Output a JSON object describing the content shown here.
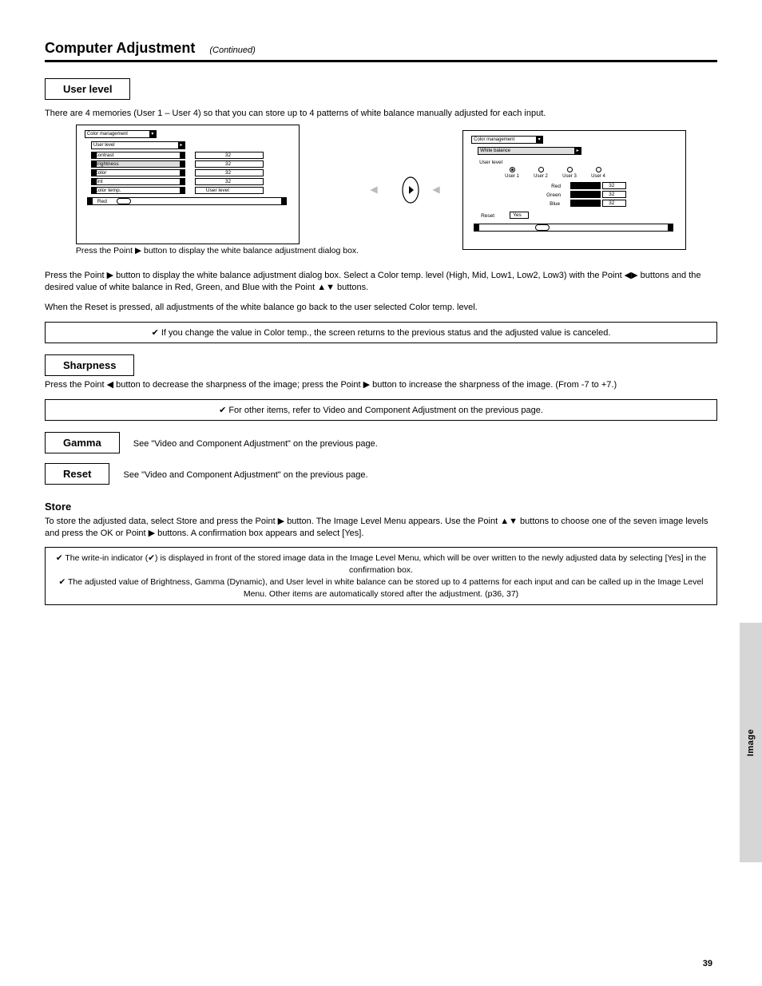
{
  "header": {
    "title": "Computer Adjustment",
    "subtitle": "(Continued)"
  },
  "sections": {
    "user_level": {
      "label": "User level",
      "intro": "There are 4 memories (User 1 – User 4) so that you can store up to 4 patterns of white balance manually adjusted for each input.",
      "figure_caption": "Press the Point ▶ button to display the white balance adjustment dialog box.",
      "left_panel": {
        "title_dropdown": "Color management",
        "mode_dropdown": "User level",
        "rowlabels": [
          "Contrast",
          "Brightness",
          "Color",
          "Tint",
          "Color temp."
        ],
        "slider_label": "Red",
        "numbers": [
          "32",
          "32",
          "32",
          "32"
        ],
        "colortemp_value": "User level"
      },
      "right_panel": {
        "title_dropdown": "Color management",
        "sub_dropdown": "White balance",
        "radio_header": "User level",
        "radios": [
          "User 1",
          "User 2",
          "User 3",
          "User 4"
        ],
        "rgb_labels": [
          "Red",
          "Green",
          "Blue"
        ],
        "rgb_values": [
          "32",
          "32",
          "32"
        ],
        "reset_label": "Reset",
        "yes_label": "Yes"
      },
      "body1": "Press the Point ▶ button to display the white balance adjustment dialog box. Select a Color temp. level (High, Mid, Low1, Low2, Low3) with the Point ◀▶ buttons and the desired value of white balance in Red, Green, and Blue with the Point ▲▼ buttons.",
      "body2": "When the Reset is pressed, all adjustments of the white balance go back to the user selected Color temp. level."
    },
    "note1": "✔ If you change the value in Color temp., the screen returns to the previous status and the adjusted value is canceled.",
    "sharpness": {
      "label": "Sharpness",
      "text": "Press the Point ◀ button to decrease the sharpness of the image; press the Point ▶ button to increase the sharpness of the image. (From -7 to +7.)"
    },
    "note2": "✔ For other items, refer to Video and Component Adjustment on the previous page.",
    "gamma": {
      "label": "Gamma",
      "text": "See \"Video and Component Adjustment\" on the previous page."
    },
    "reset": {
      "label": "Reset",
      "text": "See \"Video and Component Adjustment\" on the previous page."
    },
    "store": {
      "label": "Store",
      "text": "To store the adjusted data, select Store and press the Point ▶ button. The Image Level Menu appears. Use the Point ▲▼ buttons to choose one of the seven image levels and press the OK or Point ▶ buttons. A confirmation box appears and select [Yes]."
    },
    "note3_lines": [
      "✔ The write-in indicator (✔) is displayed in front of the stored image data in the Image Level Menu, which will be over written to the newly adjusted data by selecting [Yes] in the confirmation box.",
      "✔ The adjusted value of Brightness, Gamma (Dynamic), and User level in white balance can be stored up to 4 patterns for each input and can be called up in the Image Level Menu. Other items are automatically stored after the adjustment. (p36, 37)"
    ]
  },
  "tab": "Image",
  "page_number": "39"
}
